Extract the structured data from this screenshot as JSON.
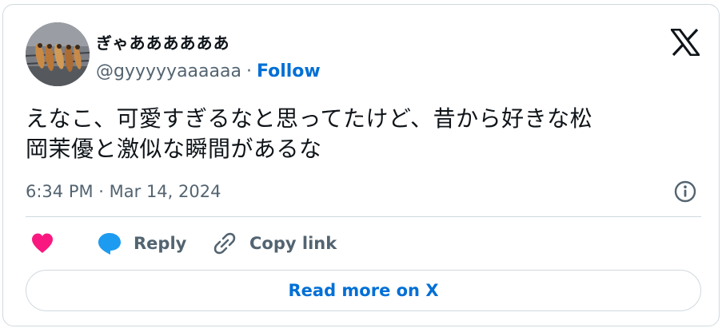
{
  "tweet": {
    "author": {
      "display_name": "ぎゃああああああ",
      "handle": "@gyyyyyaaaaaa",
      "separator": "·",
      "follow_label": "Follow",
      "avatar_icon": "avatar-image-icon"
    },
    "logo_icon": "x-logo-icon",
    "text_line1": "えなこ、可愛すぎるなと思ってたけど、昔から好きな松",
    "text_line2": "岡茉優と激似な瞬間があるな",
    "timestamp": "6:34 PM · Mar 14, 2024",
    "info_icon": "info-icon"
  },
  "actions": {
    "like_icon": "heart-icon",
    "reply_icon": "speech-bubble-icon",
    "reply_label": "Reply",
    "copy_icon": "link-icon",
    "copy_label": "Copy link"
  },
  "read_more_label": "Read more on X",
  "colors": {
    "text": "#0f1419",
    "secondary": "#536471",
    "link_blue": "#006fd6",
    "like_pink": "#f91880",
    "reply_blue": "#1d9bf0",
    "border": "#cfd9de"
  }
}
